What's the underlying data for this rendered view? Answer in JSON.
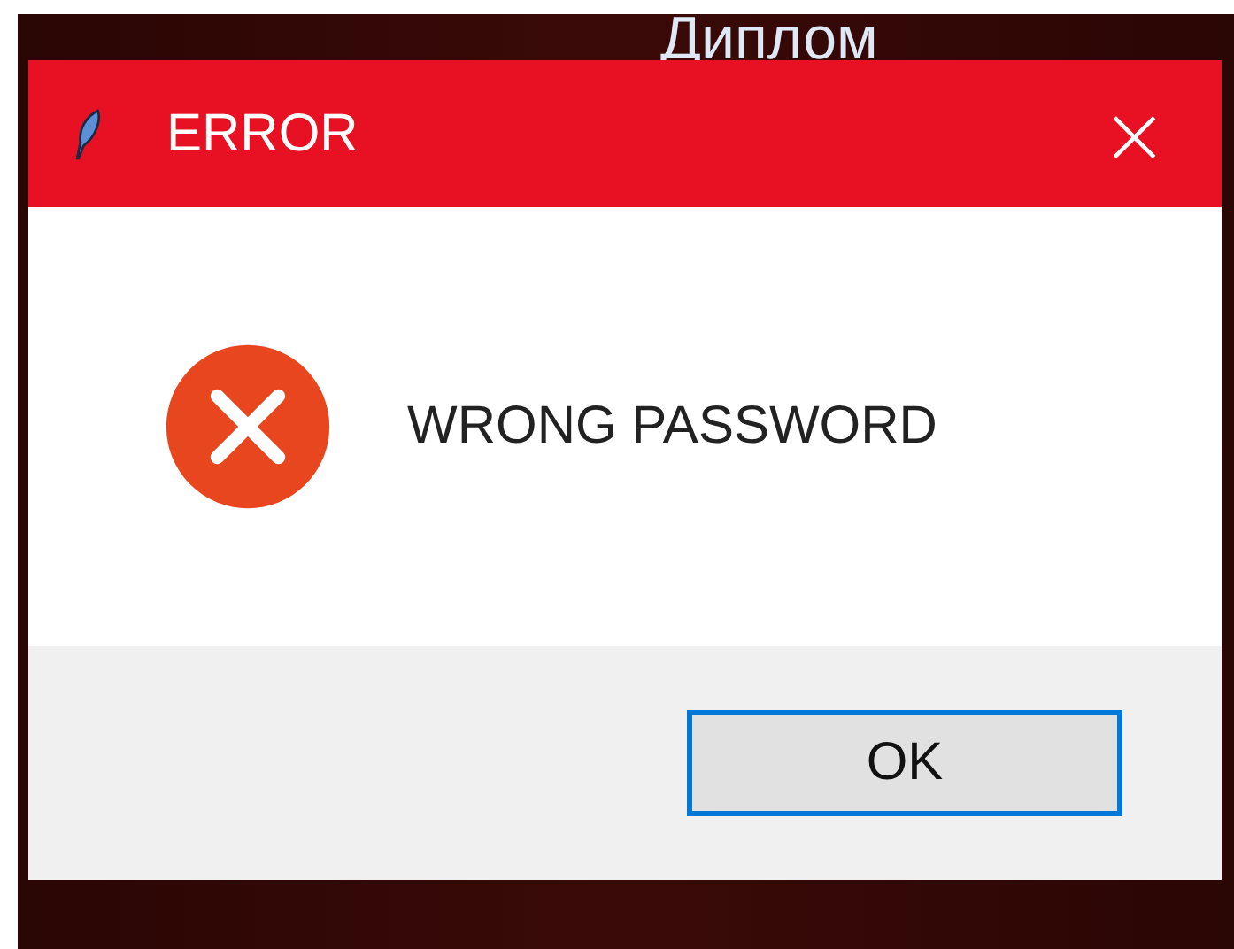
{
  "desktop": {
    "icon_label": "Диплом"
  },
  "window": {
    "title": "ERROR",
    "close": "×"
  },
  "message": {
    "kind": "error",
    "text": "WRONG PASSWORD"
  },
  "buttons": [
    {
      "label": "OK",
      "focused": true
    }
  ]
}
